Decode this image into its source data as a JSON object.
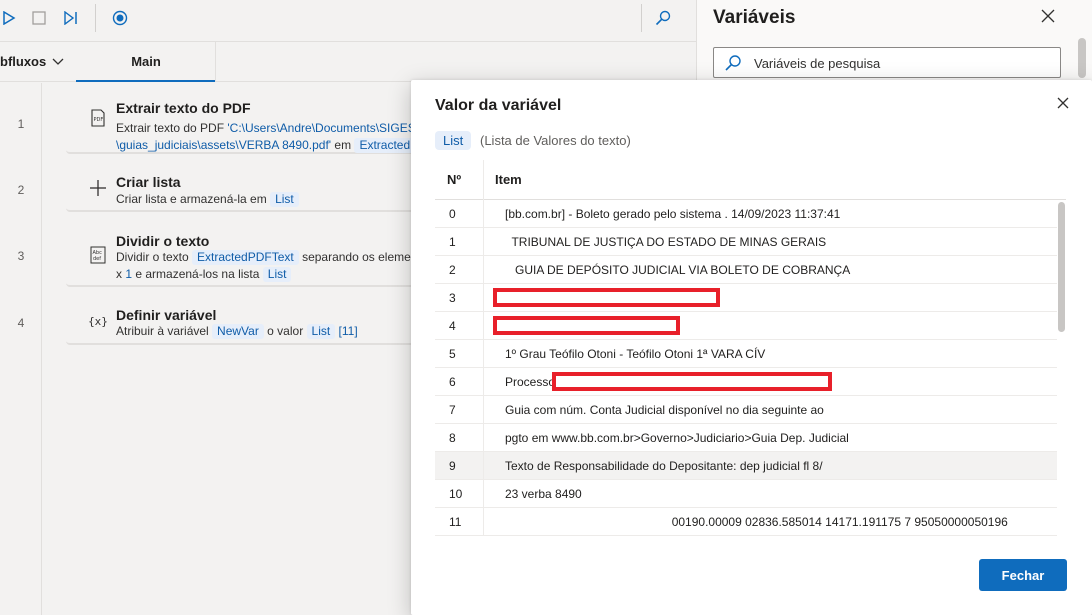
{
  "toolbar": {
    "icons": [
      "play-icon",
      "stop-icon",
      "step-icon",
      "record-icon",
      "search-icon"
    ]
  },
  "tabs": {
    "subflows_label": "bfluxos",
    "main_label": "Main"
  },
  "flow": {
    "actions": [
      {
        "line": "1",
        "icon": "pdf-icon",
        "title": "Extrair texto do PDF",
        "desc_line1_prefix": "Extrair texto do PDF ",
        "desc_line1_path": "'C:\\Users\\Andre\\Documents\\SIGES-",
        "desc_line2_path": "\\guias_judiciais\\assets\\VERBA 8490.pdf'",
        "desc_line2_mid": " em ",
        "desc_line2_var": "ExtractedP"
      },
      {
        "line": "2",
        "icon": "plus-icon",
        "title": "Criar lista",
        "desc_prefix": "Criar lista e armazená-la em ",
        "desc_var": "List"
      },
      {
        "line": "3",
        "icon": "split-text-icon",
        "title": "Dividir o texto",
        "desc_line1_prefix": "Dividir o texto ",
        "desc_line1_var": "ExtractedPDFText",
        "desc_line1_suffix": " separando os eleme",
        "desc_line2_prefix": "x ",
        "desc_line2_num": "1",
        "desc_line2_mid": " e armazená-los na lista ",
        "desc_line2_var": "List"
      },
      {
        "line": "4",
        "icon": "variable-icon",
        "title": "Definir variável",
        "desc_prefix": "Atribuir à variável ",
        "desc_var1": "NewVar",
        "desc_mid": " o valor ",
        "desc_var2": "List",
        "desc_index": " [11]"
      }
    ]
  },
  "variables_panel": {
    "title": "Variáveis",
    "search_placeholder": "Variáveis de pesquisa"
  },
  "dialog": {
    "title": "Valor da variável",
    "type_pill": "List",
    "type_desc": "(Lista de Valores do texto)",
    "col_no": "Nº",
    "col_item": "Item",
    "rows": [
      {
        "no": "0",
        "item": "[bb.com.br] - Boleto gerado pelo sistema . 14/09/2023 11:37:41"
      },
      {
        "no": "1",
        "item": "  TRIBUNAL DE JUSTIÇA DO ESTADO DE MINAS GERAIS"
      },
      {
        "no": "2",
        "item": "   GUIA DE DEPÓSITO JUDICIAL VIA BOLETO DE COBRANÇA"
      },
      {
        "no": "3",
        "item": ""
      },
      {
        "no": "4",
        "item": ""
      },
      {
        "no": "5",
        "item": "1º Grau Teófilo Otoni - Teófilo Otoni 1ª VARA CÍV"
      },
      {
        "no": "6",
        "item": "Processo"
      },
      {
        "no": "7",
        "item": "Guia com núm. Conta Judicial disponível no dia seguinte ao"
      },
      {
        "no": "8",
        "item": "pgto em www.bb.com.br>Governo>Judiciario>Guia Dep. Judicial"
      },
      {
        "no": "9",
        "item": "Texto de Responsabilidade do Depositante: dep judicial fl 8/"
      },
      {
        "no": "10",
        "item": "23 verba 8490"
      },
      {
        "no": "11",
        "item": "                                                  00190.00009 02836.585014 14171.191175 7 95050000050196"
      }
    ],
    "selected_row": 9,
    "close_button": "Fechar",
    "redaction_color": "#e8202a"
  },
  "colors": {
    "accent": "#0f6cbd",
    "pill_bg": "#e6eefa",
    "pill_text": "#0f5ca8"
  }
}
